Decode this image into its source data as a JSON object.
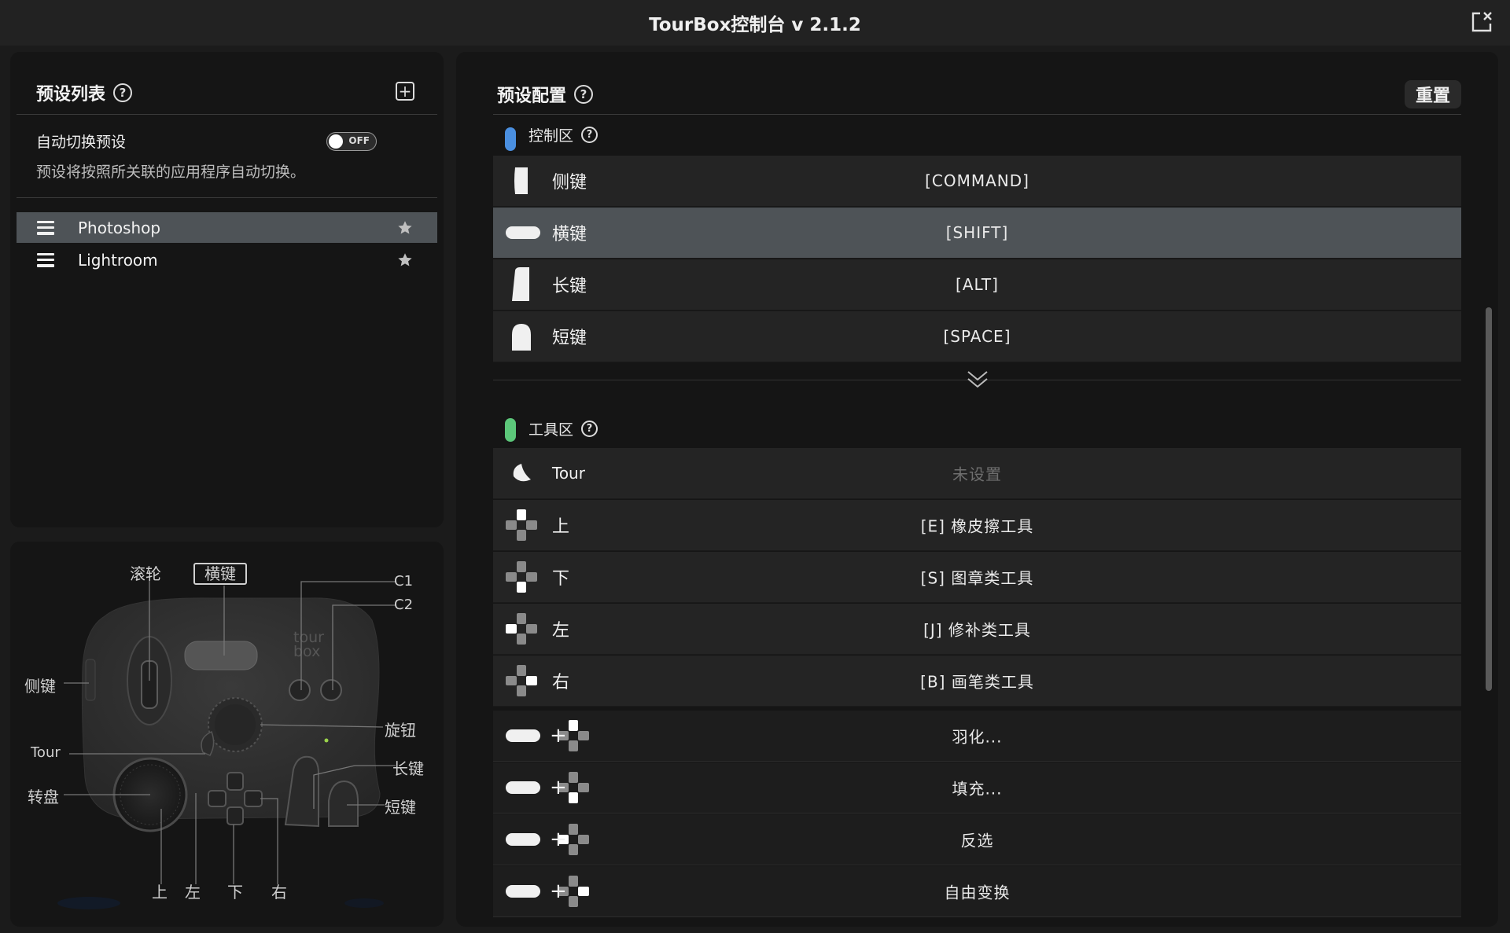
{
  "app": {
    "title": "TourBox控制台 v 2.1.2"
  },
  "preset_list": {
    "title": "预设列表",
    "auto_switch_label": "自动切换预设",
    "auto_switch_state": "OFF",
    "auto_switch_desc": "预设将按照所关联的应用程序自动切换。",
    "items": [
      {
        "name": "Photoshop",
        "active": true
      },
      {
        "name": "Lightroom",
        "active": false
      }
    ]
  },
  "device_map": {
    "labels": {
      "scroll": "滚轮",
      "tall": "横键",
      "c1": "C1",
      "c2": "C2",
      "side": "侧键",
      "knob": "旋钮",
      "tour": "Tour",
      "long": "长键",
      "dial": "转盘",
      "short": "短键",
      "up": "上",
      "left": "左",
      "down": "下",
      "right": "右"
    }
  },
  "config": {
    "title": "预设配置",
    "reset_label": "重置",
    "control_section": {
      "title": "控制区",
      "color": "#4a8fe0",
      "rows": [
        {
          "name": "侧键",
          "value": "[COMMAND]",
          "icon": "side-key-icon"
        },
        {
          "name": "横键",
          "value": "[SHIFT]",
          "icon": "tall-key-icon",
          "highlighted": true
        },
        {
          "name": "长键",
          "value": "[ALT]",
          "icon": "long-key-icon"
        },
        {
          "name": "短键",
          "value": "[SPACE]",
          "icon": "short-key-icon"
        }
      ]
    },
    "tool_section": {
      "title": "工具区",
      "color": "#5cc77a",
      "rows": [
        {
          "name": "Tour",
          "value": "未设置",
          "icon": "tour-key-icon",
          "unset": true
        },
        {
          "name": "上",
          "value": "[E] 橡皮擦工具",
          "icon": "dpad-up-icon"
        },
        {
          "name": "下",
          "value": "[S] 图章类工具",
          "icon": "dpad-down-icon"
        },
        {
          "name": "左",
          "value": "[J] 修补类工具",
          "icon": "dpad-left-icon"
        },
        {
          "name": "右",
          "value": "[B] 画笔类工具",
          "icon": "dpad-right-icon"
        }
      ],
      "combos": [
        {
          "plus": "+",
          "value": "羽化...",
          "icon": "dpad-up-icon"
        },
        {
          "plus": "+",
          "value": "填充...",
          "icon": "dpad-down-icon"
        },
        {
          "plus": "+",
          "value": "反选",
          "icon": "dpad-left-icon"
        },
        {
          "plus": "+",
          "value": "自由变换",
          "icon": "dpad-right-icon"
        }
      ]
    }
  }
}
